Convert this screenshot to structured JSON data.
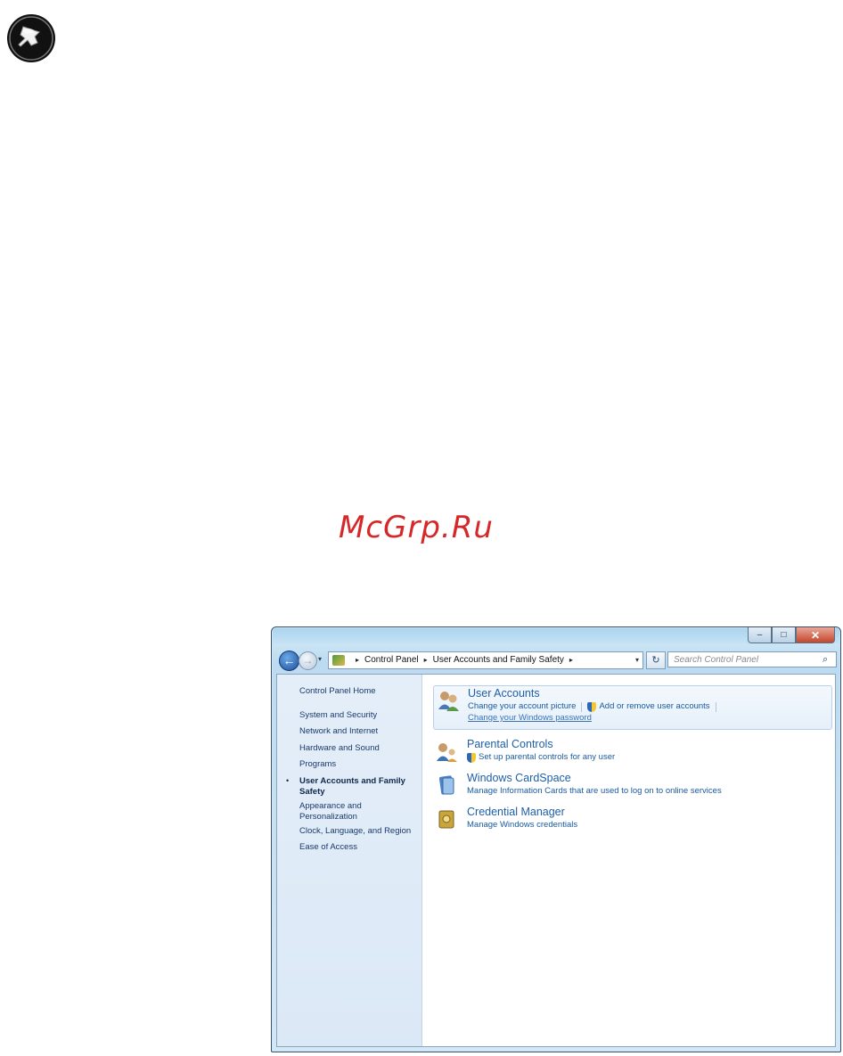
{
  "watermark": "McGrp.Ru",
  "window": {
    "caption_buttons": {
      "minimize": "–",
      "maximize": "□",
      "close": "✕"
    },
    "nav": {
      "back": "←",
      "forward": "→",
      "dropdown": "▾"
    },
    "breadcrumb": [
      "Control Panel",
      "User Accounts and Family Safety"
    ],
    "search_placeholder": "Search Control Panel",
    "refresh_glyph": "↻",
    "search_glyph": "⌕"
  },
  "sidebar": {
    "home": "Control Panel Home",
    "items": [
      "System and Security",
      "Network and Internet",
      "Hardware and Sound",
      "Programs",
      "User Accounts and Family Safety",
      "Appearance and Personalization",
      "Clock, Language, and Region",
      "Ease of Access"
    ],
    "active_index": 4,
    "bullet": "•"
  },
  "categories": [
    {
      "title": "User Accounts",
      "links": [
        "Change your account picture",
        "Add or remove user accounts",
        "Change your Windows password"
      ]
    },
    {
      "title": "Parental Controls",
      "links": [
        "Set up parental controls for any user"
      ]
    },
    {
      "title": "Windows CardSpace",
      "links": [
        "Manage Information Cards that are used to log on to online services"
      ]
    },
    {
      "title": "Credential Manager",
      "links": [
        "Manage Windows credentials"
      ]
    }
  ],
  "icons": {
    "note": "pushpin-icon",
    "user_accounts": "users-icon",
    "parental_controls": "parental-controls-icon",
    "cardspace": "cardspace-icon",
    "credential_manager": "vault-icon",
    "shield": "uac-shield-icon"
  },
  "colors": {
    "link": "#1a5aa0",
    "title": "#1e5fa8",
    "watermark": "#d62828"
  }
}
